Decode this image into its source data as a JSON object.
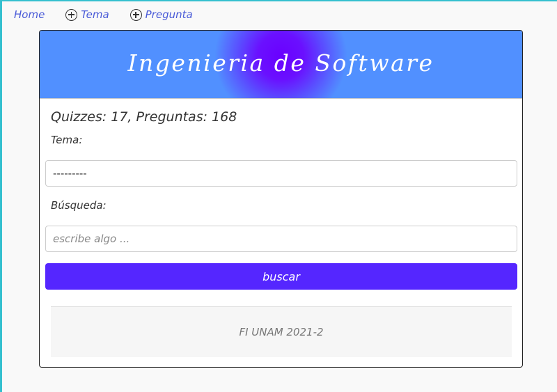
{
  "nav": {
    "home_label": "Home",
    "tema_label": "Tema",
    "pregunta_label": "Pregunta"
  },
  "banner": {
    "title": "Ingenieria de Software"
  },
  "stats": {
    "text": "Quizzes: 17, Preguntas: 168"
  },
  "form": {
    "tema_label": "Tema:",
    "tema_selected": "---------",
    "busqueda_label": "Búsqueda:",
    "busqueda_placeholder": "escribe algo ...",
    "buscar_label": "buscar"
  },
  "footer": {
    "text": "FI UNAM 2021-2"
  },
  "colors": {
    "accent": "#5526ff",
    "banner_center": "#6a00ff",
    "banner_edge": "#5190ff",
    "link": "#4a5bd8"
  },
  "icons": [
    "plus-circle-icon"
  ]
}
